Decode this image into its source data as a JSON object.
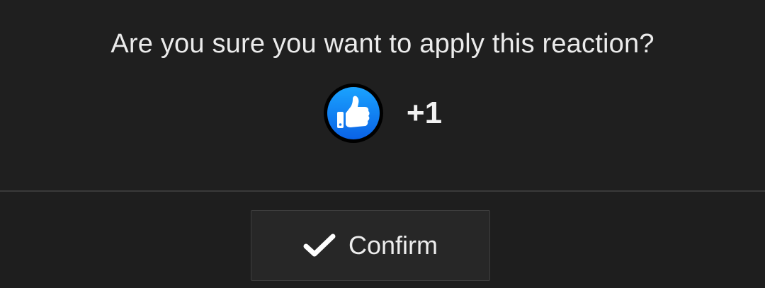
{
  "dialog": {
    "question": "Are you sure you want to apply this reaction?",
    "reaction": {
      "icon": "thumbs-up-icon",
      "label": "+1",
      "icon_color": "#1877f2"
    },
    "confirm_button": {
      "icon": "check-icon",
      "label": "Confirm"
    }
  },
  "colors": {
    "background": "#1f1f1f",
    "text": "#ebebeb",
    "button_background": "#272727",
    "divider": "#3a3a3a"
  }
}
